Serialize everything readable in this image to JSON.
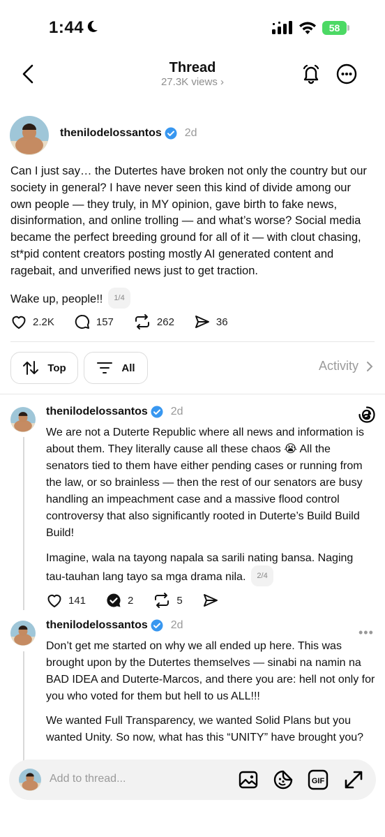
{
  "status": {
    "time": "1:44",
    "battery": "58"
  },
  "header": {
    "title": "Thread",
    "views": "27.3K views"
  },
  "post": {
    "author": "thenilodelossantos",
    "time": "2d",
    "text": "Can I just say… the Dutertes have broken not only the country but our society in general? I have never seen this kind of divide among our own people — they truly, in MY opinion, gave birth to fake news, disinformation, and online trolling — and what’s worse? Social media became the perfect breeding ground for all of it — with clout chasing, st*pid content creators posting mostly AI generated content and ragebait, and unverified news just to get traction.",
    "text2": "Wake up, people!!",
    "page": "1/4",
    "likes": "2.2K",
    "comments": "157",
    "reposts": "262",
    "shares": "36"
  },
  "filters": {
    "sort_label": "Top",
    "filter_label": "All",
    "activity_label": "Activity"
  },
  "replies": [
    {
      "author": "thenilodelossantos",
      "time": "2d",
      "text": "We are not a Duterte Republic where all news and information is about them. They literally cause all these chaos 😭 All the senators tied to them have either pending cases or running from the law, or so brainless — then the rest of our senators are busy handling an impeachment case and a massive flood control controversy that also significantly rooted in Duterte’s Build Build Build!",
      "text2": "Imagine, wala na tayong napala sa sarili nating bansa. Naging tau-tauhan lang tayo sa mga drama nila.",
      "page": "2/4",
      "likes": "141",
      "comments": "2",
      "reposts": "5"
    },
    {
      "author": "thenilodelossantos",
      "time": "2d",
      "text": "Don’t get me started on why we all ended up here. This was brought upon by the Dutertes themselves — sinabi na namin na BAD IDEA and Duterte-Marcos, and there you are: hell not only for you who voted for them but hell to us ALL!!!",
      "text2": "We wanted Full Transparency, we wanted Solid Plans but you wanted Unity. So now, what has this “UNITY” have brought you?"
    }
  ],
  "composer": {
    "placeholder": "Add to thread..."
  }
}
